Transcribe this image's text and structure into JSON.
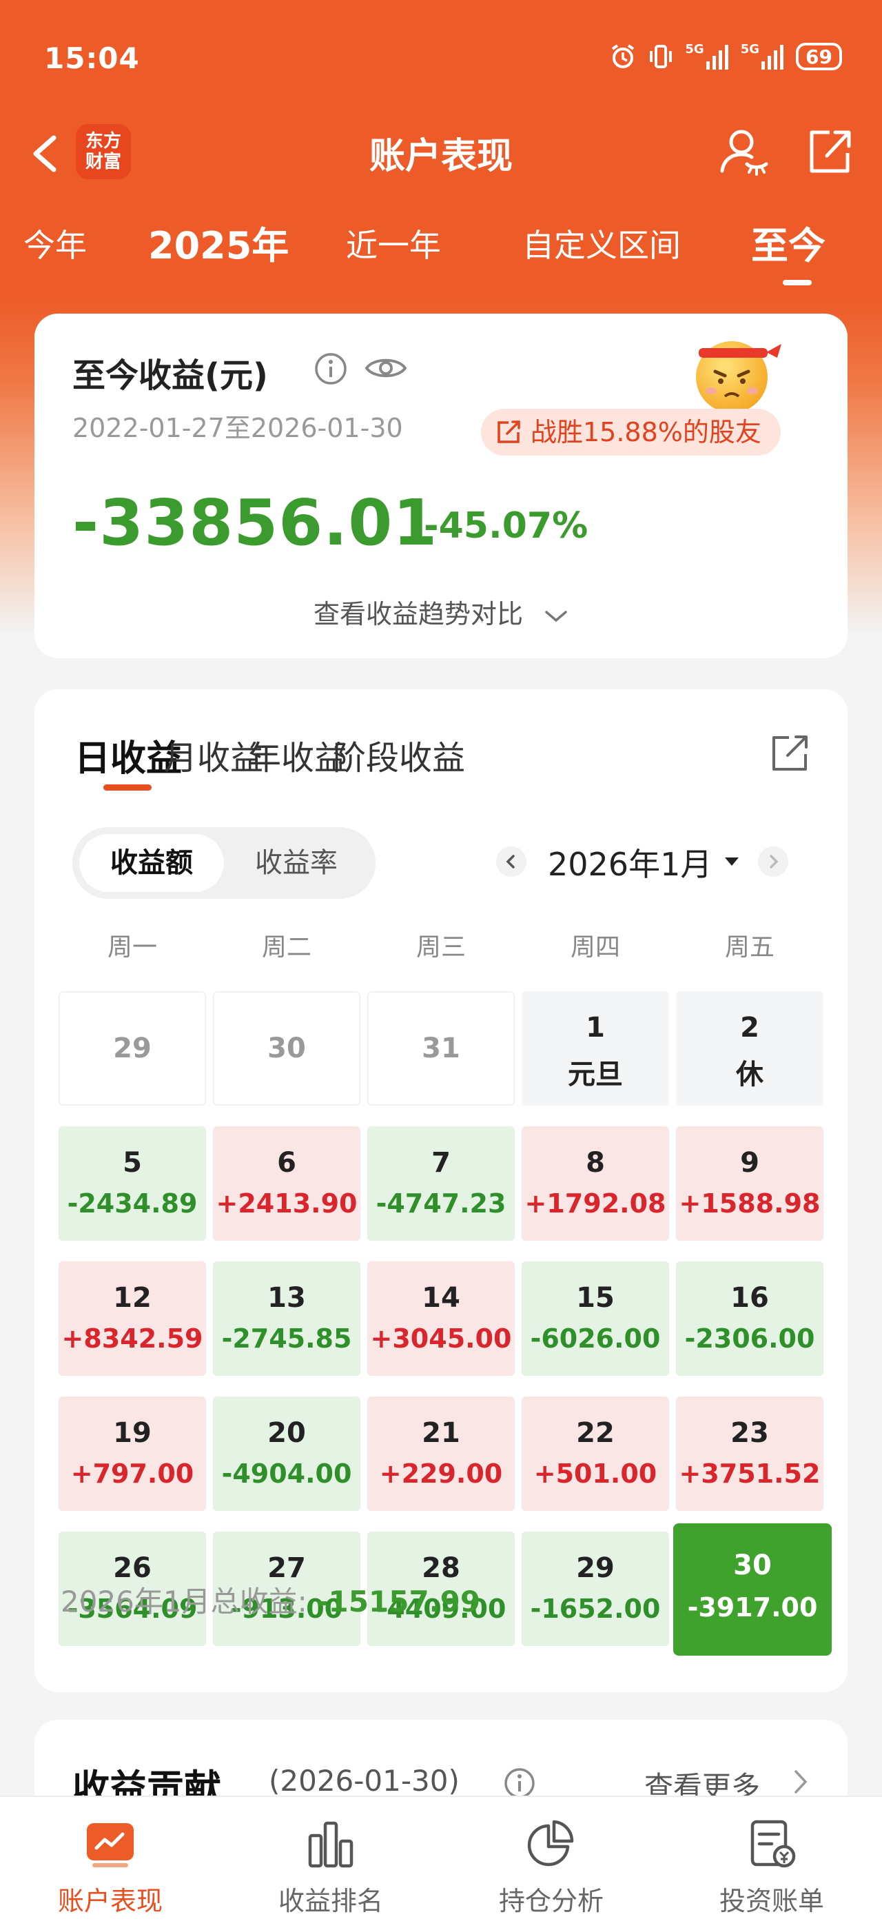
{
  "status_bar": {
    "time": "15:04",
    "signal1": "5G",
    "signal2": "5G",
    "battery": "69"
  },
  "nav": {
    "logo_text": "东方\n财富",
    "title": "账户表现"
  },
  "range_tabs": [
    "今年",
    "2025年",
    "近一年",
    "自定义区间",
    "至今"
  ],
  "summary": {
    "title": "至今收益(元)",
    "date_range": "2022-01-27至2026-01-30",
    "beat_text": "战胜15.88%的股友",
    "amount": "-33856.01",
    "percent": "-45.07%",
    "trend_link": "查看收益趋势对比"
  },
  "profit": {
    "tabs": [
      "日收益",
      "月收益",
      "年收益",
      "阶段收益"
    ],
    "segment": [
      "收益额",
      "收益率"
    ],
    "month": "2026年1月",
    "weekdays": [
      "周一",
      "周二",
      "周三",
      "周四",
      "周五"
    ],
    "weeks": [
      [
        {
          "day": "29",
          "value": "",
          "type": "prev"
        },
        {
          "day": "30",
          "value": "",
          "type": "prev"
        },
        {
          "day": "31",
          "value": "",
          "type": "prev"
        },
        {
          "day": "1",
          "value": "元旦",
          "type": "hol"
        },
        {
          "day": "2",
          "value": "休",
          "type": "hol"
        }
      ],
      [
        {
          "day": "5",
          "value": "-2434.89",
          "type": "neg"
        },
        {
          "day": "6",
          "value": "+2413.90",
          "type": "pos"
        },
        {
          "day": "7",
          "value": "-4747.23",
          "type": "neg"
        },
        {
          "day": "8",
          "value": "+1792.08",
          "type": "pos"
        },
        {
          "day": "9",
          "value": "+1588.98",
          "type": "pos"
        }
      ],
      [
        {
          "day": "12",
          "value": "+8342.59",
          "type": "pos"
        },
        {
          "day": "13",
          "value": "-2745.85",
          "type": "neg"
        },
        {
          "day": "14",
          "value": "+3045.00",
          "type": "pos"
        },
        {
          "day": "15",
          "value": "-6026.00",
          "type": "neg"
        },
        {
          "day": "16",
          "value": "-2306.00",
          "type": "neg"
        }
      ],
      [
        {
          "day": "19",
          "value": "+797.00",
          "type": "pos"
        },
        {
          "day": "20",
          "value": "-4904.00",
          "type": "neg"
        },
        {
          "day": "21",
          "value": "+229.00",
          "type": "pos"
        },
        {
          "day": "22",
          "value": "+501.00",
          "type": "pos"
        },
        {
          "day": "23",
          "value": "+3751.52",
          "type": "pos"
        }
      ],
      [
        {
          "day": "26",
          "value": "-3564.09",
          "type": "neg"
        },
        {
          "day": "27",
          "value": "-913.00",
          "type": "neg"
        },
        {
          "day": "28",
          "value": "-4409.00",
          "type": "neg"
        },
        {
          "day": "29",
          "value": "-1652.00",
          "type": "neg"
        },
        {
          "day": "30",
          "value": "-3917.00",
          "type": "sel"
        }
      ]
    ],
    "total_label": "2026年1月总收益: ",
    "total_value": "-15157.99"
  },
  "contribution": {
    "title": "收益贡献",
    "date": "(2026-01-30)",
    "more": "查看更多"
  },
  "bottom_nav": [
    "账户表现",
    "收益排名",
    "持仓分析",
    "投资账单"
  ],
  "colors": {
    "brand": "#ec5b28",
    "loss": "#3c9b2e",
    "gain": "#d8262c"
  }
}
